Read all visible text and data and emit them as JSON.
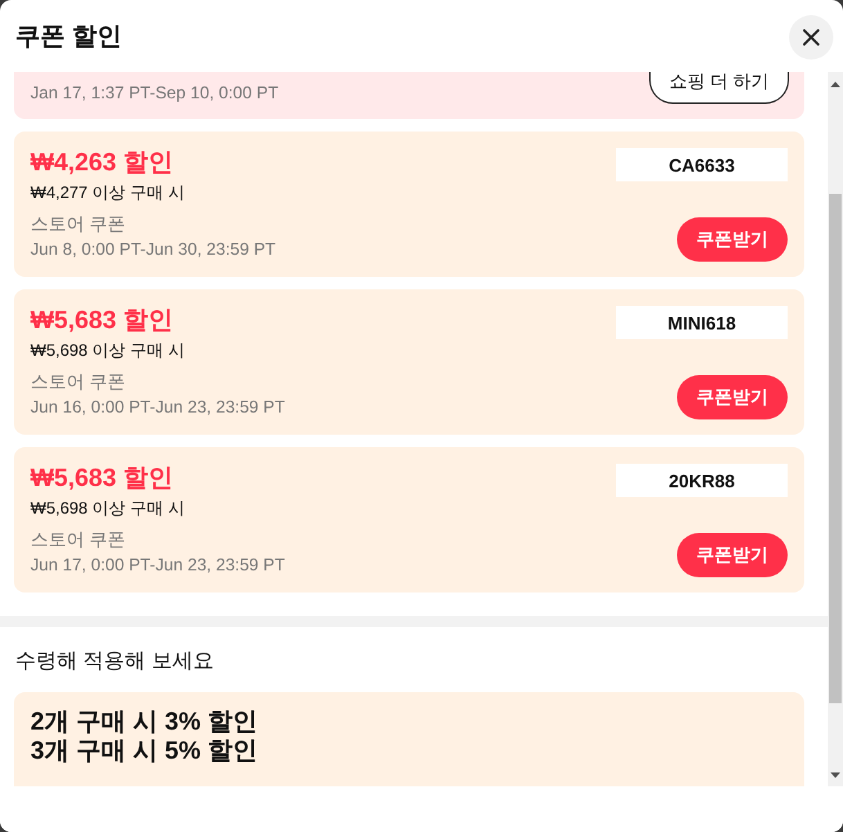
{
  "dialog": {
    "title": "쿠폰 할인"
  },
  "top_coupon": {
    "validity": "Jan 17, 1:37 PT-Sep 10, 0:00 PT",
    "button": "쇼핑 더 하기"
  },
  "coupons": [
    {
      "discount": "₩4,263 할인",
      "condition": "₩4,277 이상 구매 시",
      "type": "스토어 쿠폰",
      "validity": "Jun 8, 0:00 PT-Jun 30, 23:59 PT",
      "code": "CA6633",
      "button": "쿠폰받기"
    },
    {
      "discount": "₩5,683 할인",
      "condition": "₩5,698 이상 구매 시",
      "type": "스토어 쿠폰",
      "validity": "Jun 16, 0:00 PT-Jun 23, 23:59 PT",
      "code": "MINI618",
      "button": "쿠폰받기"
    },
    {
      "discount": "₩5,683 할인",
      "condition": "₩5,698 이상 구매 시",
      "type": "스토어 쿠폰",
      "validity": "Jun 17, 0:00 PT-Jun 23, 23:59 PT",
      "code": "20KR88",
      "button": "쿠폰받기"
    }
  ],
  "apply_section": {
    "heading": "수령해 적용해 보세요",
    "offers": [
      {
        "lines": [
          "2개 구매 시 3% 할인",
          "3개 구매 시 5% 할인"
        ]
      }
    ]
  }
}
